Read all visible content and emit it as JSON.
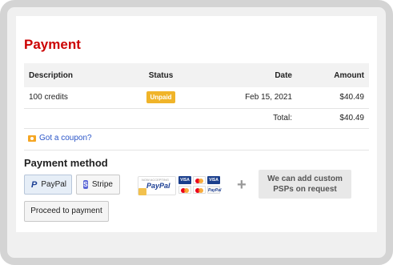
{
  "page_title": "Payment",
  "table": {
    "headers": {
      "description": "Description",
      "status": "Status",
      "date": "Date",
      "amount": "Amount"
    },
    "rows": [
      {
        "description": "100 credits",
        "status": "Unpaid",
        "date": "Feb 15, 2021",
        "amount": "$40.49"
      }
    ],
    "total_label": "Total:",
    "total_amount": "$40.49"
  },
  "coupon": {
    "label": "Got a coupon?",
    "icon": "coupon-icon"
  },
  "payment_method": {
    "title": "Payment method",
    "options": [
      {
        "label": "PayPal",
        "icon": "paypal-icon",
        "selected": true
      },
      {
        "label": "Stripe",
        "icon": "stripe-icon",
        "selected": false
      }
    ],
    "custom_psp_line1": "We can add custom",
    "custom_psp_line2": "PSPs on request",
    "plus_symbol": "+"
  },
  "proceed_label": "Proceed to payment",
  "colors": {
    "title_red": "#cc0000",
    "badge_yellow": "#f0b429",
    "link_blue": "#2a55c8",
    "paypal_blue": "#1c3f94",
    "stripe_purple": "#5a66d6"
  }
}
